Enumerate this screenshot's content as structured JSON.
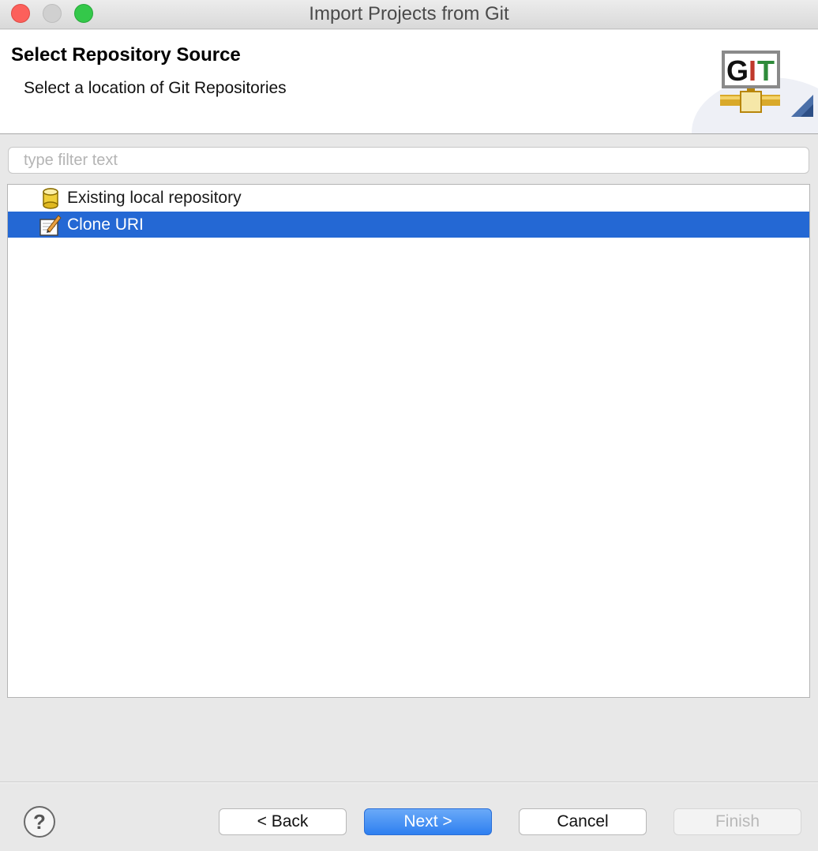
{
  "window": {
    "title": "Import Projects from Git"
  },
  "header": {
    "title": "Select Repository Source",
    "subtitle": "Select a location of Git Repositories",
    "logo_text": "GIT",
    "logo_icon": "git-logo-icon"
  },
  "filter": {
    "value": "",
    "placeholder": "type filter text"
  },
  "tree": {
    "items": [
      {
        "label": "Existing local repository",
        "icon": "repository-cylinder-icon",
        "selected": false
      },
      {
        "label": "Clone URI",
        "icon": "clone-uri-pencil-icon",
        "selected": true
      }
    ]
  },
  "buttons": {
    "help_label": "?",
    "back_label": "< Back",
    "next_label": "Next >",
    "cancel_label": "Cancel",
    "finish_label": "Finish"
  },
  "colors": {
    "selection": "#2468d4",
    "default_button": "#2e7ff0",
    "disabled_text": "#b8b8b8"
  }
}
